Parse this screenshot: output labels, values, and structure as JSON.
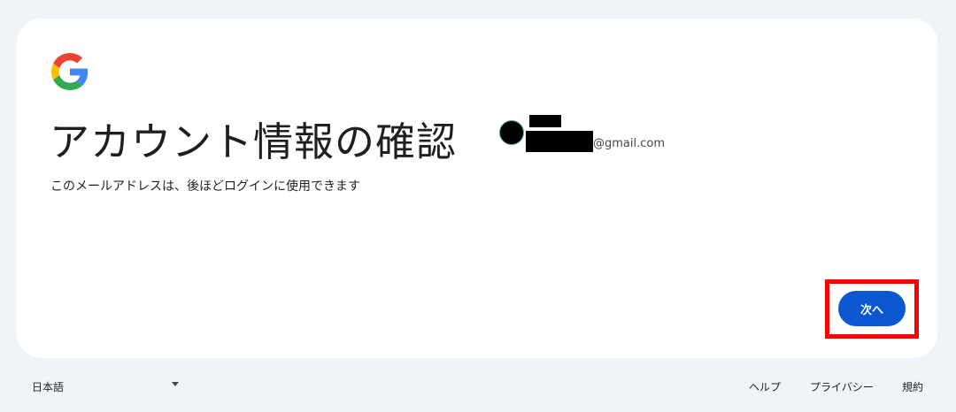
{
  "brand": {
    "logo_icon": "google-g-icon",
    "colors": {
      "blue": "#4285F4",
      "red": "#EA4335",
      "yellow": "#FBBC05",
      "green": "#34A853"
    }
  },
  "main": {
    "title": "アカウント情報の確認",
    "subtitle": "このメールアドレスは、後ほどログインに使用できます",
    "account": {
      "avatar_icon": "avatar",
      "email_suffix": "@gmail.com"
    },
    "next_button": {
      "label": "次へ",
      "color": "#0b57d0"
    },
    "highlight_color": "#ff0000"
  },
  "footer": {
    "language": {
      "selected": "日本語",
      "icon": "caret-down-icon"
    },
    "links": [
      "ヘルプ",
      "プライバシー",
      "規約"
    ]
  }
}
